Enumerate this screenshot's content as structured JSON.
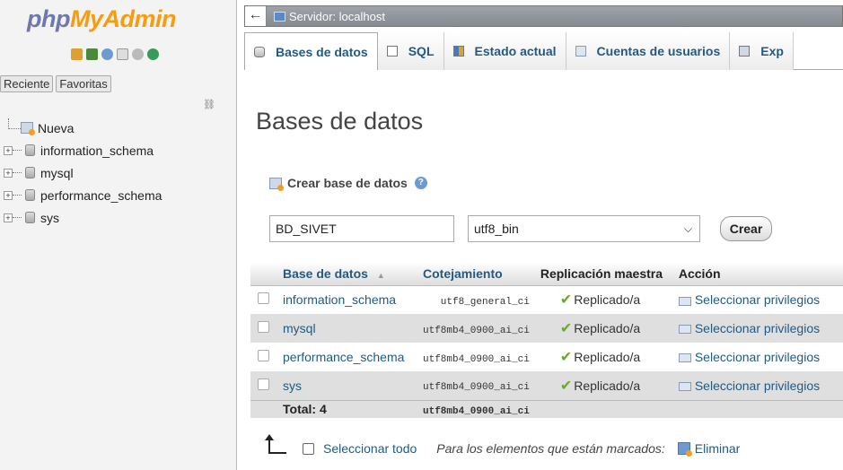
{
  "nav": {
    "logo_php": "php",
    "logo_myadmin": "MyAdmin",
    "tabs": [
      "Reciente",
      "Favoritas"
    ],
    "tree": [
      {
        "label": "Nueva"
      },
      {
        "label": "information_schema"
      },
      {
        "label": "mysql"
      },
      {
        "label": "performance_schema"
      },
      {
        "label": "sys"
      }
    ]
  },
  "topbar": {
    "server_label": "Servidor: localhost"
  },
  "menu": {
    "tabs": [
      {
        "label": "Bases de datos",
        "icon": "database-icon"
      },
      {
        "label": "SQL",
        "icon": "sql-icon"
      },
      {
        "label": "Estado actual",
        "icon": "status-icon"
      },
      {
        "label": "Cuentas de usuarios",
        "icon": "users-icon"
      },
      {
        "label": "Exp",
        "icon": "export-icon"
      }
    ]
  },
  "main": {
    "title": "Bases de datos",
    "create": {
      "header": "Crear base de datos",
      "dbname_value": "BD_SIVET",
      "collation_value": "utf8_bin",
      "create_button": "Crear"
    },
    "table": {
      "headers": {
        "database": "Base de datos",
        "sort_arrow": "▲",
        "collation": "Cotejamiento",
        "replication": "Replicación maestra",
        "action": "Acción"
      },
      "rows": [
        {
          "name": "information_schema",
          "collation": "utf8_general_ci",
          "replication": "Replicado/a",
          "action": "Seleccionar privilegios"
        },
        {
          "name": "mysql",
          "collation": "utf8mb4_0900_ai_ci",
          "replication": "Replicado/a",
          "action": "Seleccionar privilegios"
        },
        {
          "name": "performance_schema",
          "collation": "utf8mb4_0900_ai_ci",
          "replication": "Replicado/a",
          "action": "Seleccionar privilegios"
        },
        {
          "name": "sys",
          "collation": "utf8mb4_0900_ai_ci",
          "replication": "Replicado/a",
          "action": "Seleccionar privilegios"
        }
      ],
      "total_label": "Total: 4",
      "total_collation": "utf8mb4_0900_ai_ci"
    },
    "footer": {
      "select_all": "Seleccionar todo",
      "for_marked": "Para los elementos que están marcados:",
      "delete": "Eliminar"
    }
  }
}
